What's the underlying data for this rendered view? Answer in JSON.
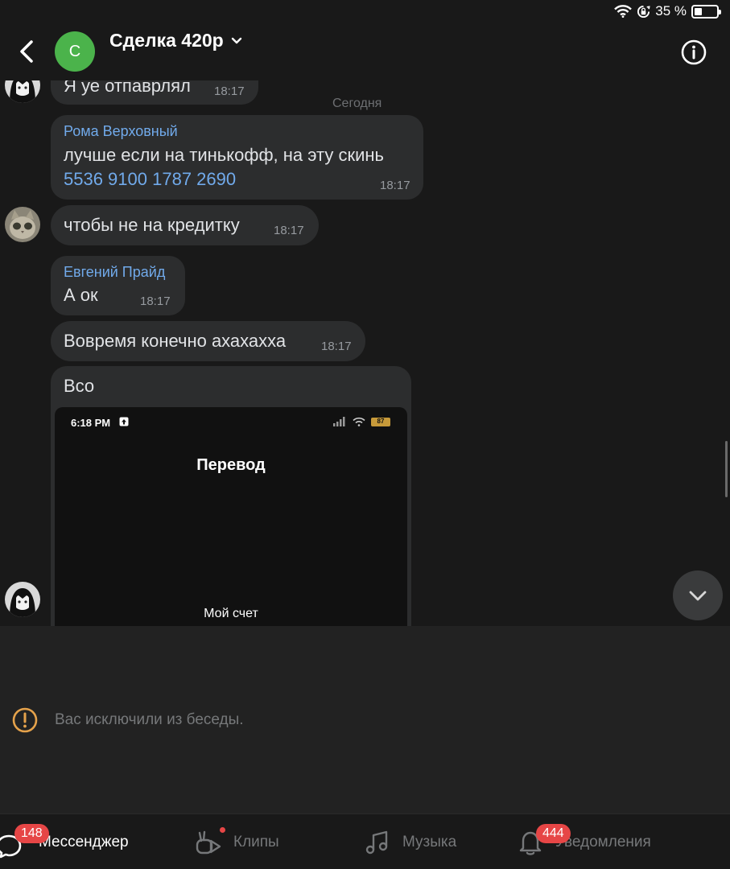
{
  "status_bar": {
    "battery": "35 %",
    "battery_level": 0.35
  },
  "header": {
    "avatar_letter": "С",
    "title": "Сделка 420р"
  },
  "messages": [
    {
      "text": "Я уе отпаврлял",
      "time": "18:17"
    },
    {
      "sender": "Рома Верховный",
      "text": "лучше если на тинькофф, на эту скинь",
      "link": "5536 9100 1787 2690",
      "time": "18:17"
    },
    {
      "text": "чтобы не на кредитку",
      "time": "18:17"
    },
    {
      "sender": "Евгений Прайд",
      "text": "А ок",
      "time": "18:17"
    },
    {
      "text": "Вовремя конечно ахахахха",
      "time": "18:17"
    },
    {
      "text": "Всо"
    }
  ],
  "day_separator": "Сегодня",
  "screenshot": {
    "time": "6:18 PM",
    "battery": "87",
    "title": "Перевод",
    "account": "Мой счет"
  },
  "notice": "Вас исключили из беседы.",
  "tabs": [
    {
      "label": "Мессенджер",
      "badge": "148",
      "icon": "messenger-icon",
      "active": true
    },
    {
      "label": "Клипы",
      "icon": "clips-icon",
      "dot": true
    },
    {
      "label": "Музыка",
      "icon": "music-icon"
    },
    {
      "label": "Уведомления",
      "badge": "444",
      "icon": "bell-icon"
    }
  ],
  "colors": {
    "background": "#191919",
    "bubble": "#2c2d2e",
    "accent": "#71aaeb",
    "badge": "#e64646",
    "avatar": "#4bb34b",
    "warning": "#e5a24b"
  }
}
